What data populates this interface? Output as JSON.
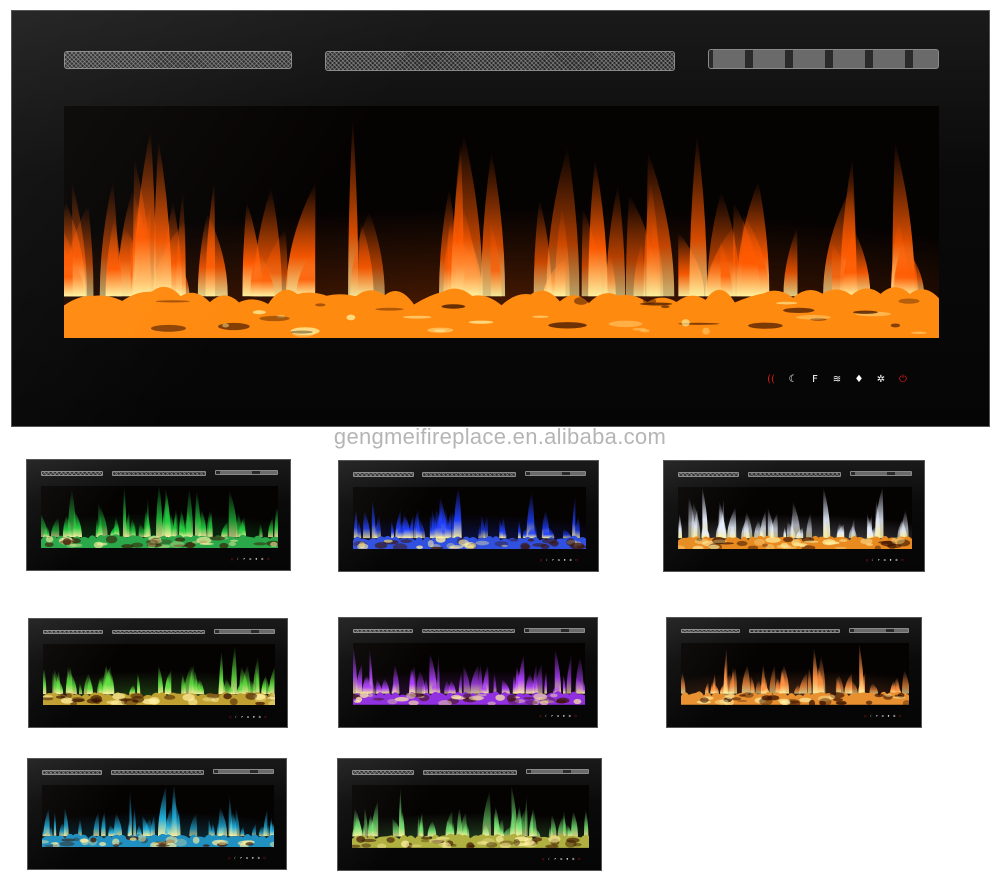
{
  "watermark": "gengmeifireplace.en.alibaba.com",
  "main": {
    "controls": [
      {
        "icon": "remote-icon",
        "glyph": "((",
        "color": "#e01818"
      },
      {
        "icon": "timer-icon",
        "glyph": "☾",
        "color": "#ffffff"
      },
      {
        "icon": "fahrenheit-icon",
        "glyph": "F",
        "color": "#ffffff"
      },
      {
        "icon": "heat-icon",
        "glyph": "≋",
        "color": "#ffffff"
      },
      {
        "icon": "flame-icon",
        "glyph": "♦",
        "color": "#ffffff"
      },
      {
        "icon": "light-icon",
        "glyph": "✲",
        "color": "#ffffff"
      },
      {
        "icon": "power-icon",
        "glyph": "⏻",
        "color": "#e01818"
      }
    ],
    "flame_color": "#ff5a00",
    "ember_color": "#ff8a10"
  },
  "variants": [
    {
      "name": "green",
      "flame": "#22d040",
      "ember": "#2aa84a"
    },
    {
      "name": "blue",
      "flame": "#2040ff",
      "ember": "#3050e0"
    },
    {
      "name": "white-amber",
      "flame": "#e8f0ff",
      "ember": "#e88a20"
    },
    {
      "name": "multicolor-green",
      "flame": "#60e040",
      "ember": "#c0a030"
    },
    {
      "name": "purple",
      "flame": "#b040ff",
      "ember": "#9030e0"
    },
    {
      "name": "amber-orange",
      "flame": "#ff9040",
      "ember": "#e89030"
    },
    {
      "name": "teal-blue",
      "flame": "#20b0e0",
      "ember": "#2090c0"
    },
    {
      "name": "green-yellow",
      "flame": "#70e070",
      "ember": "#b0b040"
    }
  ]
}
